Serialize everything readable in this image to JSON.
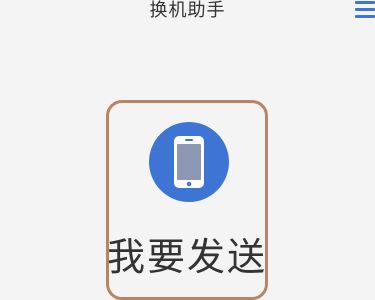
{
  "header": {
    "title": "换机助手"
  },
  "icons": {
    "menu": "menu-icon",
    "phone": "phone-icon"
  },
  "main": {
    "send_label": "我要发送"
  },
  "colors": {
    "background": "#f4f4f4",
    "card_border": "#b98463",
    "icon_circle": "#3e74d4",
    "menu": "#3e74d4",
    "text": "#333333"
  }
}
